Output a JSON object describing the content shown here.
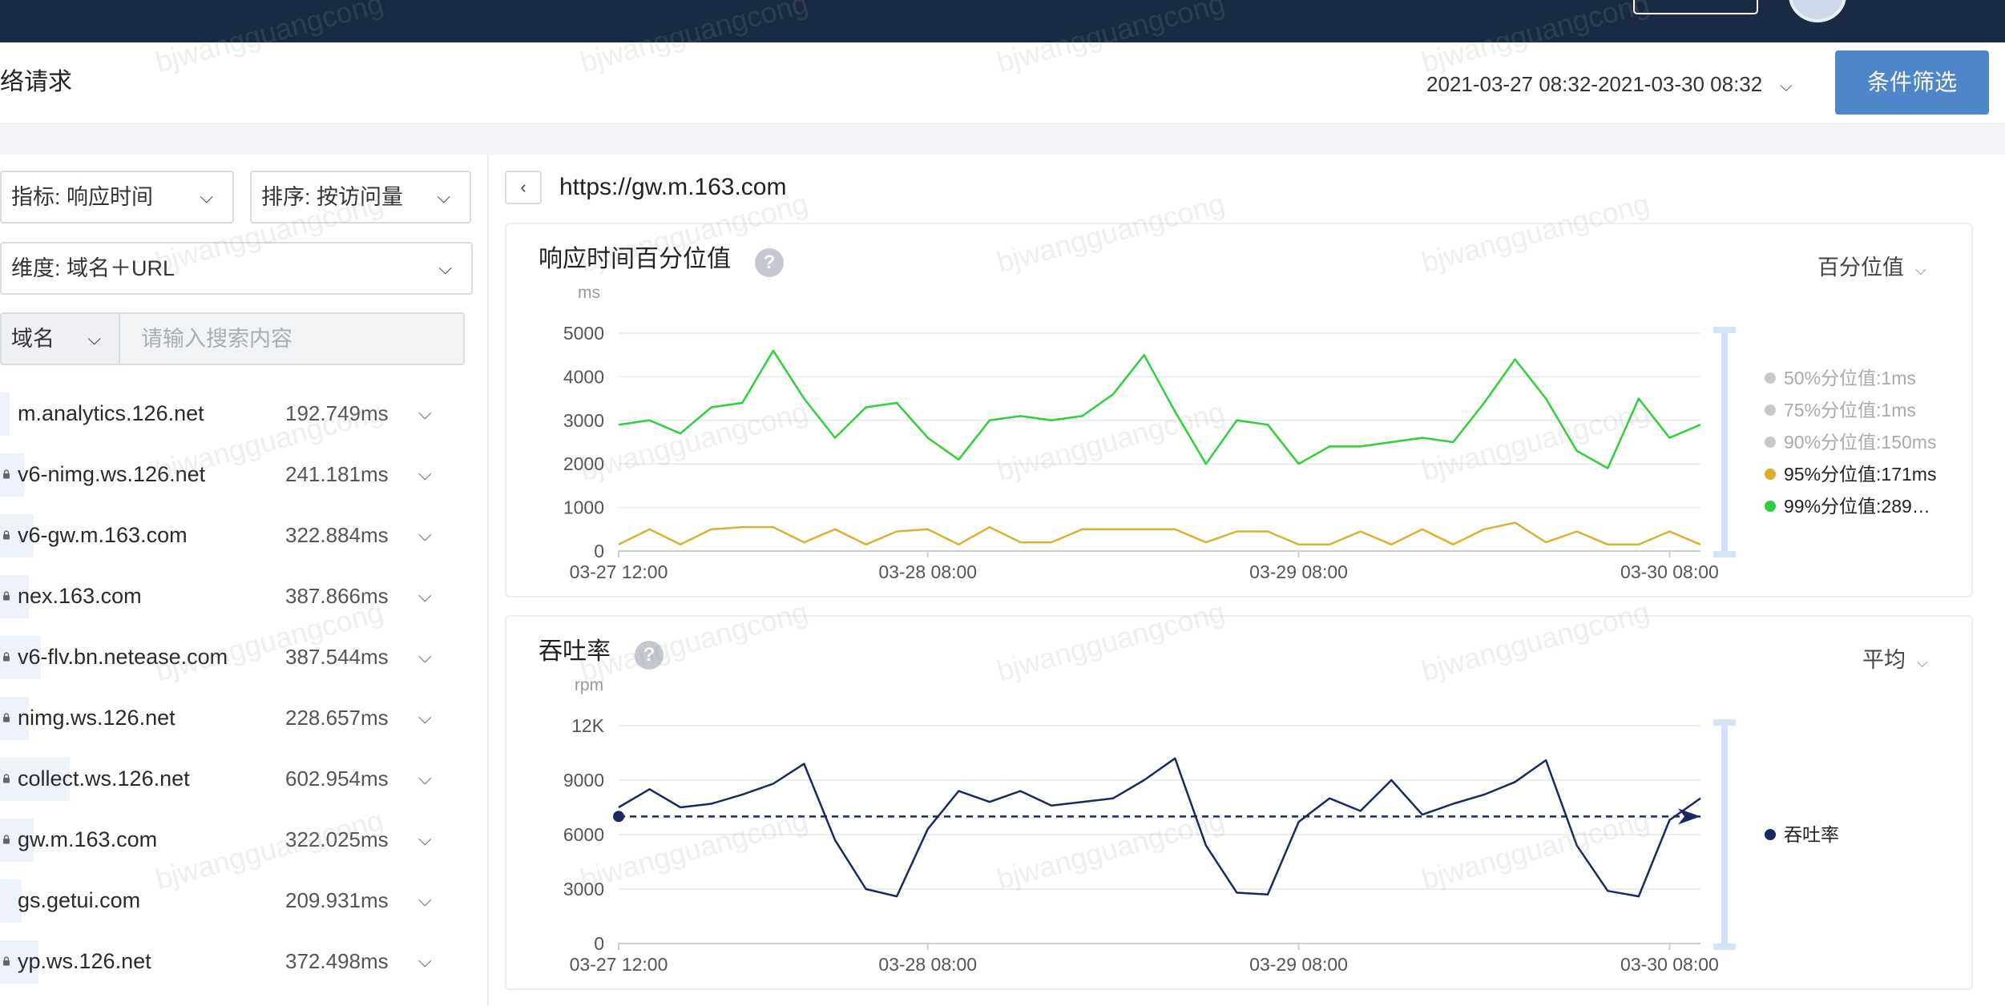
{
  "header": {
    "title": "络请求",
    "date_range": "2021-03-27 08:32-2021-03-30 08:32",
    "filter_button": "条件筛选"
  },
  "controls": {
    "metric_select": "指标: 响应时间",
    "sort_select": "排序: 按访问量",
    "dimension_select": "维度: 域名＋URL",
    "search_prefix": "域名",
    "search_placeholder": "请输入搜索内容"
  },
  "domain_list": [
    {
      "host": "m.analytics.126.net",
      "value": "192.749ms",
      "locked": false,
      "bar": 0.02
    },
    {
      "host": "v6-nimg.ws.126.net",
      "value": "241.181ms",
      "locked": true,
      "bar": 0.05
    },
    {
      "host": "v6-gw.m.163.com",
      "value": "322.884ms",
      "locked": true,
      "bar": 0.07
    },
    {
      "host": "nex.163.com",
      "value": "387.866ms",
      "locked": true,
      "bar": 0.06
    },
    {
      "host": "v6-flv.bn.netease.com",
      "value": "387.544ms",
      "locked": true,
      "bar": 0.085
    },
    {
      "host": "nimg.ws.126.net",
      "value": "228.657ms",
      "locked": true,
      "bar": 0.06
    },
    {
      "host": "collect.ws.126.net",
      "value": "602.954ms",
      "locked": true,
      "bar": 0.145
    },
    {
      "host": "gw.m.163.com",
      "value": "322.025ms",
      "locked": true,
      "bar": 0.07
    },
    {
      "host": "gs.getui.com",
      "value": "209.931ms",
      "locked": false,
      "bar": 0.045
    },
    {
      "host": "yp.ws.126.net",
      "value": "372.498ms",
      "locked": true,
      "bar": 0.08
    }
  ],
  "detail": {
    "url": "https://gw.m.163.com"
  },
  "chart_data": [
    {
      "type": "line",
      "title": "响应时间百分位值",
      "dropdown": "百分位值",
      "ylabel": "ms",
      "ylim": [
        0,
        5000
      ],
      "yticks": [
        0,
        1000,
        2000,
        3000,
        4000,
        5000
      ],
      "xticks": [
        "03-27 12:00",
        "03-28 08:00",
        "03-29 08:00",
        "03-30 08:00"
      ],
      "xtick_index": [
        0,
        10,
        22,
        34
      ],
      "grid": true,
      "legend_position": "right",
      "legend": [
        {
          "label": "50%分位值:1ms",
          "color": "#c8c8c8",
          "active": false
        },
        {
          "label": "75%分位值:1ms",
          "color": "#c8c8c8",
          "active": false
        },
        {
          "label": "90%分位值:150ms",
          "color": "#c8c8c8",
          "active": false
        },
        {
          "label": "95%分位值:171ms",
          "color": "#d9b02a",
          "active": true
        },
        {
          "label": "99%分位值:289…",
          "color": "#2ecc40",
          "active": true
        }
      ],
      "series": [
        {
          "name": "99%分位值",
          "color": "#2fd03a",
          "values": [
            2900,
            3000,
            2700,
            3300,
            3400,
            4600,
            3500,
            2600,
            3300,
            3400,
            2600,
            2100,
            3000,
            3100,
            3000,
            3100,
            3600,
            4500,
            3200,
            2000,
            3000,
            2900,
            2000,
            2400,
            2400,
            2500,
            2600,
            2500,
            3400,
            4400,
            3500,
            2300,
            1900,
            3500,
            2600,
            2900
          ]
        },
        {
          "name": "95%分位值",
          "color": "#dbb131",
          "values": [
            150,
            500,
            150,
            500,
            550,
            550,
            200,
            500,
            150,
            450,
            500,
            150,
            550,
            200,
            200,
            500,
            500,
            500,
            500,
            200,
            450,
            450,
            150,
            150,
            450,
            150,
            500,
            150,
            500,
            650,
            200,
            450,
            150,
            150,
            450,
            150
          ]
        }
      ]
    },
    {
      "type": "line",
      "title": "吞吐率",
      "dropdown": "平均",
      "ylabel": "rpm",
      "ylim": [
        0,
        12000
      ],
      "yticks": [
        0,
        3000,
        6000,
        9000,
        12000
      ],
      "ytick_labels": [
        "0",
        "3000",
        "6000",
        "9000",
        "12K"
      ],
      "xticks": [
        "03-27 12:00",
        "03-28 08:00",
        "03-29 08:00",
        "03-30 08:00"
      ],
      "xtick_index": [
        0,
        10,
        22,
        34
      ],
      "grid": true,
      "legend_position": "right",
      "legend": [
        {
          "label": "吞吐率",
          "color": "#1a2a5e",
          "active": true
        }
      ],
      "series": [
        {
          "name": "吞吐率",
          "color": "#1a2a5e",
          "values": [
            7500,
            8500,
            7500,
            7700,
            8200,
            8800,
            9900,
            5700,
            3000,
            2600,
            6300,
            8400,
            7800,
            8400,
            7600,
            7800,
            8000,
            9000,
            10200,
            5400,
            2800,
            2700,
            6700,
            8000,
            7300,
            9000,
            7100,
            7700,
            8200,
            8900,
            10100,
            5400,
            2900,
            2600,
            6800,
            8000
          ]
        }
      ],
      "average": 7000
    }
  ],
  "watermark": "bjwangguangcong"
}
